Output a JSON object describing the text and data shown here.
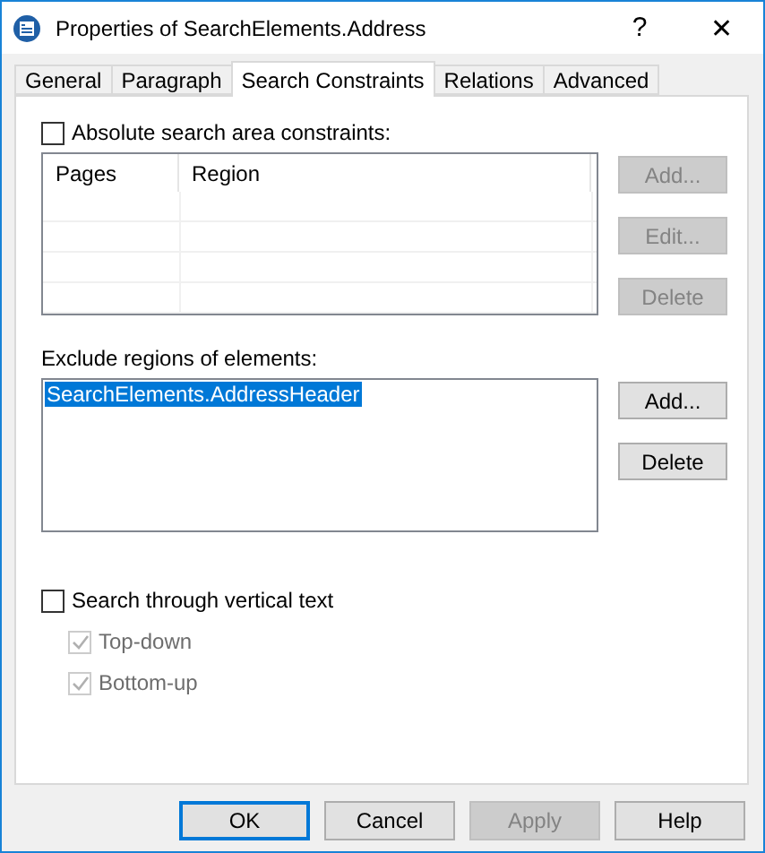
{
  "window": {
    "title": "Properties of SearchElements.Address",
    "help": "?",
    "close": "✕"
  },
  "tabs": [
    {
      "label": "General",
      "selected": false
    },
    {
      "label": "Paragraph",
      "selected": false
    },
    {
      "label": "Search Constraints",
      "selected": true
    },
    {
      "label": "Relations",
      "selected": false
    },
    {
      "label": "Advanced",
      "selected": false
    }
  ],
  "absolute": {
    "label": "Absolute search area constraints:",
    "checked": false,
    "columns": [
      "Pages",
      "Region"
    ],
    "buttons": [
      {
        "label": "Add...",
        "disabled": true
      },
      {
        "label": "Edit...",
        "disabled": true
      },
      {
        "label": "Delete",
        "disabled": true
      }
    ]
  },
  "exclude": {
    "label": "Exclude regions of elements:",
    "items": [
      {
        "text": "SearchElements.AddressHeader",
        "selected": true
      }
    ],
    "buttons": [
      {
        "label": "Add...",
        "disabled": false
      },
      {
        "label": "Delete",
        "disabled": false
      }
    ]
  },
  "vertical": {
    "label": "Search through vertical text",
    "checked": false,
    "options": [
      {
        "label": "Top-down",
        "checked": true,
        "disabled": true
      },
      {
        "label": "Bottom-up",
        "checked": true,
        "disabled": true
      }
    ]
  },
  "footer": [
    {
      "label": "OK",
      "default": true,
      "disabled": false
    },
    {
      "label": "Cancel",
      "default": false,
      "disabled": false
    },
    {
      "label": "Apply",
      "default": false,
      "disabled": true
    },
    {
      "label": "Help",
      "default": false,
      "disabled": false
    }
  ]
}
